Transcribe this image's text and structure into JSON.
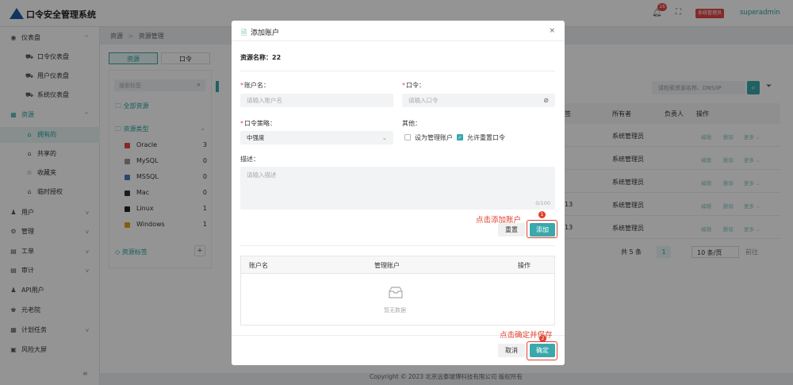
{
  "app": {
    "title": "口令安全管理系统",
    "user": "superadmin",
    "role_badge": "系统管理员",
    "notify_count": "16"
  },
  "sidebar": {
    "items": [
      {
        "icon": "◉",
        "label": "仪表盘",
        "chevron": "^"
      },
      {
        "icon": "⛟",
        "label": "口令仪表盘",
        "sub": true
      },
      {
        "icon": "⛟",
        "label": "用户仪表盘",
        "sub": true
      },
      {
        "icon": "⛟",
        "label": "系统仪表盘",
        "sub": true
      },
      {
        "icon": "▦",
        "label": "资源",
        "chevron": "^",
        "active_parent": true
      },
      {
        "icon": "⌂",
        "label": "拥有的",
        "sub": true,
        "active": true
      },
      {
        "icon": "⌂",
        "label": "共享的",
        "sub": true
      },
      {
        "icon": "☆",
        "label": "收藏夹",
        "sub": true
      },
      {
        "icon": "⌂",
        "label": "临时授权",
        "sub": true
      },
      {
        "icon": "♟",
        "label": "用户",
        "chevron": "v"
      },
      {
        "icon": "⚙",
        "label": "管理",
        "chevron": "v"
      },
      {
        "icon": "▤",
        "label": "工单",
        "chevron": "v"
      },
      {
        "icon": "▤",
        "label": "审计",
        "chevron": "v"
      },
      {
        "icon": "♟",
        "label": "API用户"
      },
      {
        "icon": "♚",
        "label": "元老院"
      },
      {
        "icon": "▦",
        "label": "计划任务",
        "chevron": "v"
      },
      {
        "icon": "▣",
        "label": "风险大屏"
      }
    ],
    "collapse": "≡"
  },
  "breadcrumb": {
    "root": "资源",
    "sep": ">",
    "current": "资源管理"
  },
  "tabs": {
    "t1": "资源",
    "t2": "口令"
  },
  "left_panel": {
    "search_placeholder": "搜索标签",
    "all_resources": "全部资源",
    "type_group": "资源类型",
    "types": [
      {
        "name": "Oracle",
        "count": "3"
      },
      {
        "name": "MySQL",
        "count": "0"
      },
      {
        "name": "MSSQL",
        "count": "0"
      },
      {
        "name": "Mac",
        "count": "0"
      },
      {
        "name": "Linux",
        "count": "1"
      },
      {
        "name": "Windows",
        "count": "1"
      }
    ],
    "tag_group": "资源标签",
    "add": "+"
  },
  "right_panel": {
    "search_placeholder": "请检索资源名称、DNS/IP",
    "col_partial": "签",
    "col_owner": "所有者",
    "col_lead": "负责人",
    "col_ops": "操作",
    "rows": [
      {
        "lead": "",
        "owner": "系统管理员"
      },
      {
        "lead": "",
        "owner": "系统管理员"
      },
      {
        "lead": "",
        "owner": "系统管理员"
      },
      {
        "lead": "13",
        "owner": "系统管理员"
      },
      {
        "lead": "13",
        "owner": "系统管理员"
      }
    ],
    "op_edit": "编辑",
    "op_delete": "删除",
    "op_more": "更多 ⌄",
    "total": "共 5 条",
    "page": "1",
    "page_size": "10 条/页",
    "goto": "前往"
  },
  "footer": "Copyright © 2023 北京远泰瑞博科技有限公司 版权所有",
  "modal": {
    "title": "添加账户",
    "close": "×",
    "resource_name": "资源名称：22",
    "account_label": "账户名：",
    "account_placeholder": "请输入账户名",
    "password_label": "口令：",
    "password_placeholder": "请输入口令",
    "policy_label": "口令策略：",
    "policy_value": "中强度",
    "other_label": "其他：",
    "cb_manage": "设为管理账户",
    "cb_reset": "允许重置口令",
    "desc_label": "描述：",
    "desc_placeholder": "请输入描述",
    "desc_count": "0/100",
    "reset_btn": "重置",
    "add_btn": "添加",
    "table": {
      "col_account": "账户名",
      "col_manage": "管理账户",
      "col_ops": "操作",
      "empty": "暂无数据"
    },
    "cancel_btn": "取消",
    "ok_btn": "确定"
  },
  "annotations": {
    "a1": "点击添加账户",
    "a1_num": "1",
    "a2": "点击确定并保存",
    "a2_num": "2"
  },
  "colors": {
    "accent": "#3aa8ac",
    "annotation": "#e0402f",
    "brand": "#1e5aa8"
  }
}
